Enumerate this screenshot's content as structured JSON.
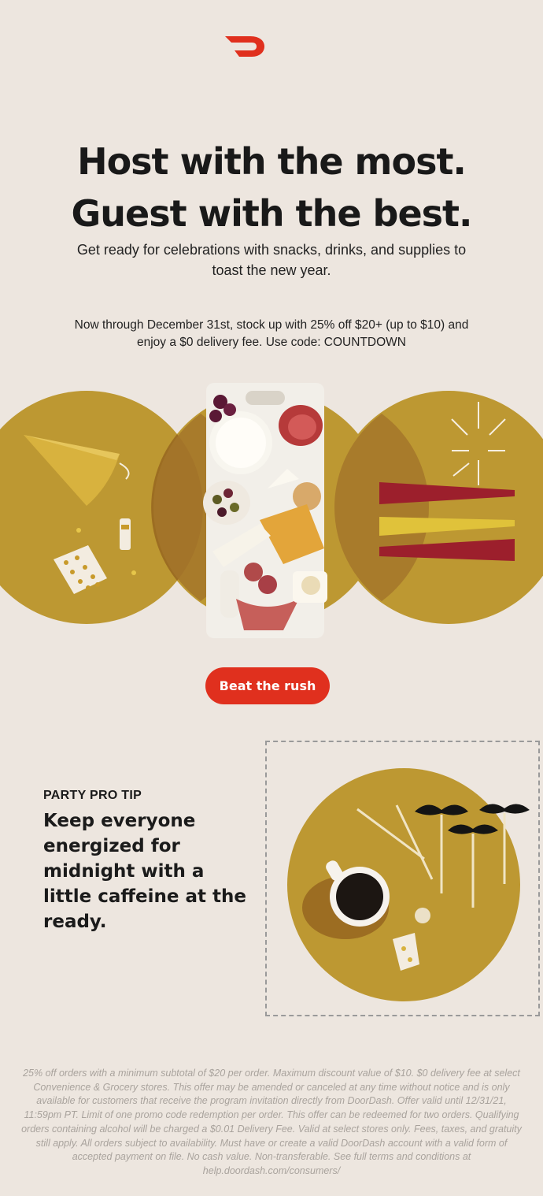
{
  "brand": {
    "logo_icon": "doordash-logo-icon",
    "accent_color": "#e0301e"
  },
  "hero": {
    "headline_line1": "Host with the most.",
    "headline_line2": "Guest with the best.",
    "subheadline": "Get ready for celebrations with snacks, drinks, and supplies to toast the new year.",
    "offer_text": "Now through December 31st, stock up with 25% off $20+ (up to $10) and enjoy a $0 delivery fee. Use code: COUNTDOWN",
    "illustration_colors": {
      "gold": "#bd9832",
      "overlap": "#9c6d22"
    },
    "cta_label": "Beat the rush"
  },
  "tip": {
    "label": "PARTY PRO TIP",
    "body": "Keep everyone energized for midnight with a little caffeine at the ready."
  },
  "legal": {
    "text": "25% off orders with a minimum subtotal of $20 per order. Maximum discount value of $10. $0 delivery fee at select Convenience & Grocery stores. This offer may be amended or canceled at any time without notice and is only available for customers that receive the program invitation directly from DoorDash. Offer valid until 12/31/21, 11:59pm PT. Limit of one promo code redemption per order. This offer can be redeemed for two orders. Qualifying orders containing alcohol will be charged a $0.01 Delivery Fee. Valid at select stores only. Fees, taxes, and gratuity still apply. All orders subject to availability. Must have or create a valid DoorDash account with a valid form of accepted payment on file. No cash value. Non-transferable. See full terms and conditions at help.doordash.com/consumers/"
  }
}
